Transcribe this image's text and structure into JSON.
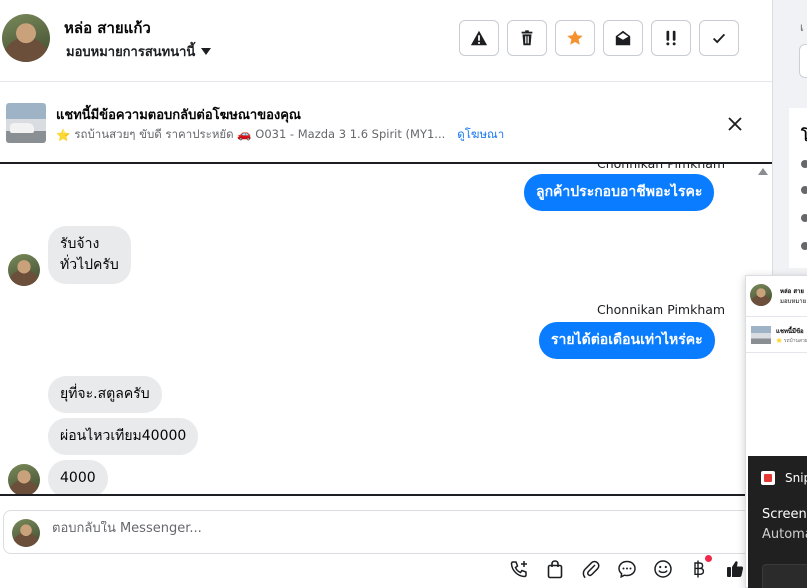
{
  "header": {
    "name": "หล่อ สายแก้ว",
    "assign_label": "มอบหมายการสนทนานี้",
    "toolbar": [
      {
        "icon": "warning-icon",
        "label": "Mark as spam"
      },
      {
        "icon": "trash-icon",
        "label": "Delete"
      },
      {
        "icon": "star-icon",
        "label": "Star"
      },
      {
        "icon": "envelope-open-icon",
        "label": "Mark as unread"
      },
      {
        "icon": "follow-up-icon",
        "label": "Follow up"
      },
      {
        "icon": "check-icon",
        "label": "Done"
      }
    ]
  },
  "ad_banner": {
    "title": "แชทนี้มีข้อความตอบกลับต่อโฆษณาของคุณ",
    "star": "⭐",
    "subtitle": "รถบ้านสวยๆ ขับดี ราคาประหยัด 🚗 O031 - Mazda 3 1.6 Spirit (MY1...",
    "link": "ดูโฆษณา"
  },
  "conversation": {
    "sender_top_clipped": "Chonnikan Pimkham",
    "messages": [
      {
        "dir": "out",
        "text": "ลูกค้าประกอบอาชีพอะไรคะ"
      },
      {
        "dir": "in",
        "text_line1": "รับจ้าง",
        "text_line2": "ทั่วไปครับ"
      },
      {
        "dir": "out",
        "sender": "Chonnikan Pimkham",
        "text": "รายได้ต่อเดือนเท่าไหร่คะ"
      },
      {
        "dir": "in",
        "text": "ยุที่จะ.สตูลครับ"
      },
      {
        "dir": "in",
        "text": "ผ่อนไหวเทียม40000"
      },
      {
        "dir": "in",
        "text": "4000"
      }
    ]
  },
  "composer": {
    "placeholder": "ตอบกลับใน Messenger...",
    "icons": [
      "call-add-icon",
      "shopping-bag-icon",
      "paperclip-icon",
      "chat-bubble-icon",
      "emoji-icon",
      "baht-icon",
      "thumbs-up-icon"
    ]
  },
  "sidebar": {
    "clipped_text": "เ",
    "clipped_heading": "โ"
  },
  "preview": {
    "name": "หล่อ สาย",
    "sub": "มอบหมาย",
    "ad_title": "แชทนี้มีข้อ",
    "ad_sub": "⭐ รถบ้านสวย"
  },
  "snip": {
    "title": "Snip",
    "body1": "Screens",
    "body2": "Automa"
  }
}
